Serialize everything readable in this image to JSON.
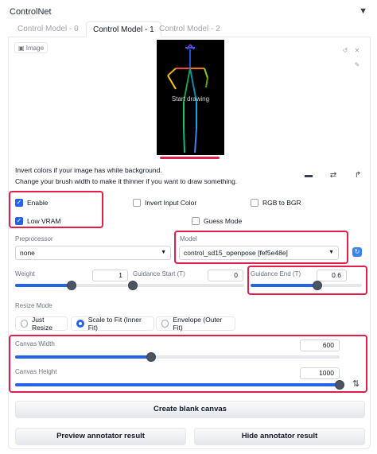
{
  "panel": {
    "title": "ControlNet",
    "collapse_icon": "▼"
  },
  "tabs": [
    {
      "label": "Control Model - 0"
    },
    {
      "label": "Control Model - 1"
    },
    {
      "label": "Control Model - 2"
    }
  ],
  "image": {
    "label": "Image",
    "canvas_text": "Start drawing"
  },
  "hints": {
    "line1": "Invert colors if your image has white background.",
    "line2": "Change your brush width to make it thinner if you want to draw something."
  },
  "checkboxes": {
    "enable": {
      "label": "Enable",
      "checked": true
    },
    "invert": {
      "label": "Invert Input Color",
      "checked": false
    },
    "rgb_bgr": {
      "label": "RGB to BGR",
      "checked": false
    },
    "low_vram": {
      "label": "Low VRAM",
      "checked": true
    },
    "guess": {
      "label": "Guess Mode",
      "checked": false
    }
  },
  "preprocessor": {
    "label": "Preprocessor",
    "value": "none"
  },
  "model": {
    "label": "Model",
    "value": "control_sd15_openpose [fef5e48e]"
  },
  "weight": {
    "label": "Weight",
    "value": "1",
    "fraction": 0.5
  },
  "guidance_start": {
    "label": "Guidance Start (T)",
    "value": "0",
    "fraction": 0.0
  },
  "guidance_end": {
    "label": "Guidance End (T)",
    "value": "0.6",
    "fraction": 0.6
  },
  "resize_mode": {
    "label": "Resize Mode",
    "options": [
      "Just Resize",
      "Scale to Fit (Inner Fit)",
      "Envelope (Outer Fit)"
    ],
    "selected": "Scale to Fit (Inner Fit)"
  },
  "canvas_width": {
    "label": "Canvas Width",
    "value": "600",
    "fraction": 0.42
  },
  "canvas_height": {
    "label": "Canvas Height",
    "value": "1000",
    "fraction": 1.0
  },
  "buttons": {
    "create": "Create blank canvas",
    "preview": "Preview annotator result",
    "hide": "Hide annotator result"
  },
  "colors": {
    "accent": "#2563eb",
    "highlight": "#e11d48"
  }
}
